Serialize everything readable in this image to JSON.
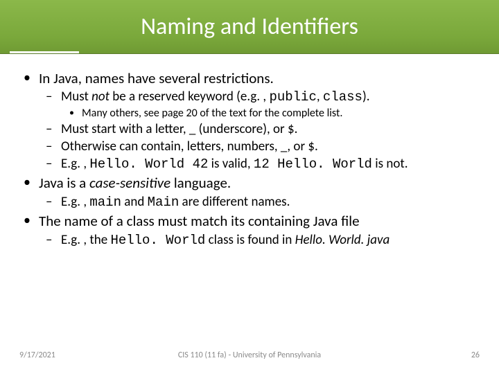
{
  "title": "Naming and Identifiers",
  "b1": {
    "text": "In Java, names have several restrictions.",
    "s1": {
      "pre": "Must ",
      "em": "not",
      "mid": " be a reserved keyword (e.g. , ",
      "kw1": "public",
      "sep": ", ",
      "kw2": "class",
      "post": ").",
      "note": "Many others, see page 20 of the text for the complete list."
    },
    "s2": "Must start with a letter, _ (underscore), or $.",
    "s3": "Otherwise can contain, letters, numbers, _, or $.",
    "s4": {
      "pre": "E.g. , ",
      "c1": "Hello. World 42",
      "mid": " is valid, ",
      "c2": "12 Hello. World",
      "post": " is not."
    }
  },
  "b2": {
    "pre": "Java is a ",
    "em": "case-sensitive",
    "post": " language.",
    "s1": {
      "pre": "E.g. , ",
      "c1": "main",
      "mid": " and ",
      "c2": "Main",
      "post": " are different names."
    }
  },
  "b3": {
    "text": "The name of a class must match its containing Java file",
    "s1": {
      "pre": "E.g. , the ",
      "c1": "Hello. World",
      "mid": " class is found in ",
      "file": "Hello. World. java"
    }
  },
  "footer": {
    "date": "9/17/2021",
    "center": "CIS 110 (11 fa) - University of Pennsylvania",
    "num": "26"
  }
}
